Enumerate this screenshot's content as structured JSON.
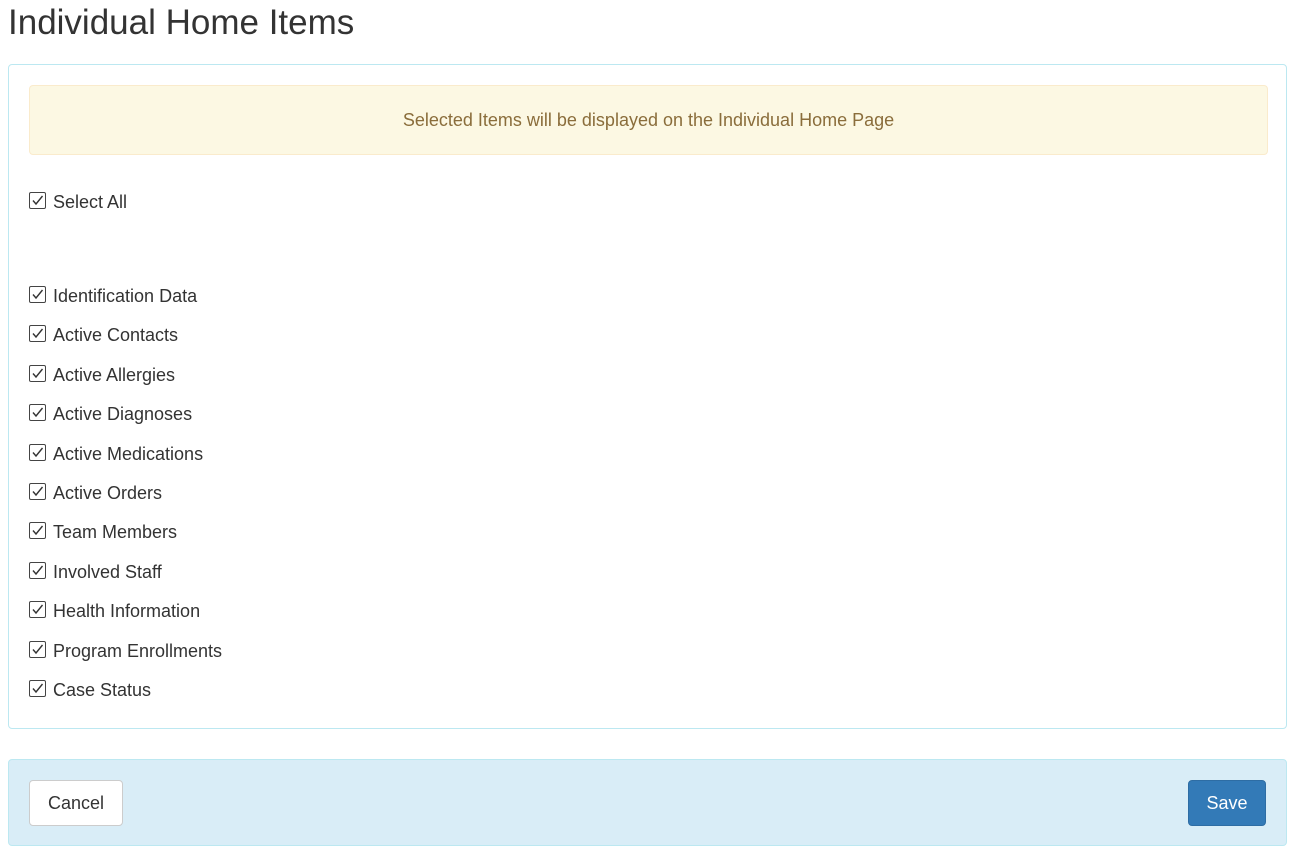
{
  "page": {
    "title": "Individual Home Items"
  },
  "notice": {
    "text": "Selected Items will be displayed on the Individual Home Page"
  },
  "select_all": {
    "label": "Select All",
    "checked": true
  },
  "items": [
    {
      "label": "Identification Data",
      "checked": true
    },
    {
      "label": "Active Contacts",
      "checked": true
    },
    {
      "label": "Active Allergies",
      "checked": true
    },
    {
      "label": "Active Diagnoses",
      "checked": true
    },
    {
      "label": "Active Medications",
      "checked": true
    },
    {
      "label": "Active Orders",
      "checked": true
    },
    {
      "label": "Team Members",
      "checked": true
    },
    {
      "label": "Involved Staff",
      "checked": true
    },
    {
      "label": "Health Information",
      "checked": true
    },
    {
      "label": "Program Enrollments",
      "checked": true
    },
    {
      "label": "Case Status",
      "checked": true
    }
  ],
  "footer": {
    "cancel_label": "Cancel",
    "save_label": "Save"
  },
  "colors": {
    "panel_border": "#bce8f1",
    "alert_bg": "#fcf8e3",
    "alert_text": "#8a6d3b",
    "footer_bg": "#d9edf7",
    "save_bg": "#337ab7"
  },
  "icons": {
    "checkbox": "checkmark-icon"
  }
}
